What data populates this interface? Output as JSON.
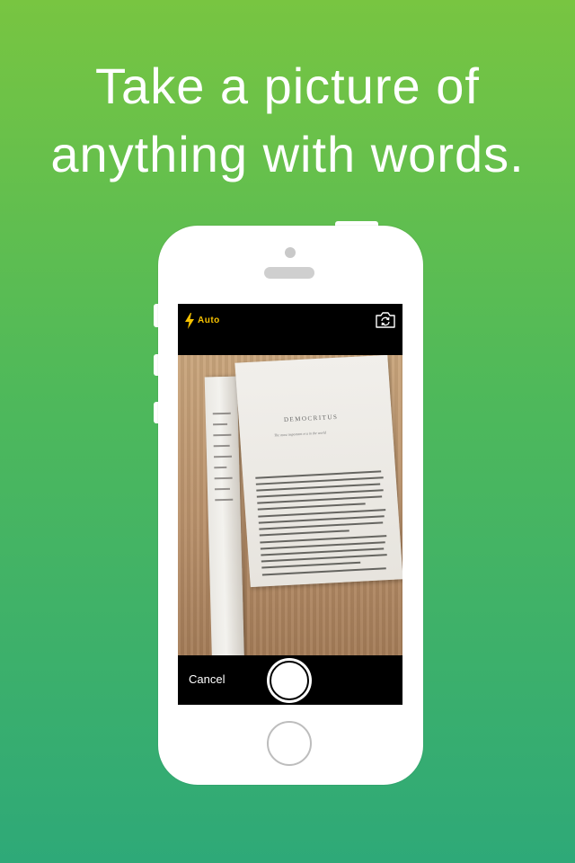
{
  "headline": {
    "line1": "Take a picture of",
    "line2": "anything with words."
  },
  "camera": {
    "flash_mode": "Auto",
    "cancel_label": "Cancel"
  },
  "book_page": {
    "title": "DEMOCRITUS",
    "subtitle": "The most important era in the world"
  },
  "colors": {
    "background_top": "#78c541",
    "background_bottom": "#2ea978",
    "flash_accent": "#f7c200",
    "phone_body": "#ffffff"
  },
  "icons": [
    "flash-icon",
    "switch-camera-icon",
    "shutter-button",
    "home-button"
  ]
}
